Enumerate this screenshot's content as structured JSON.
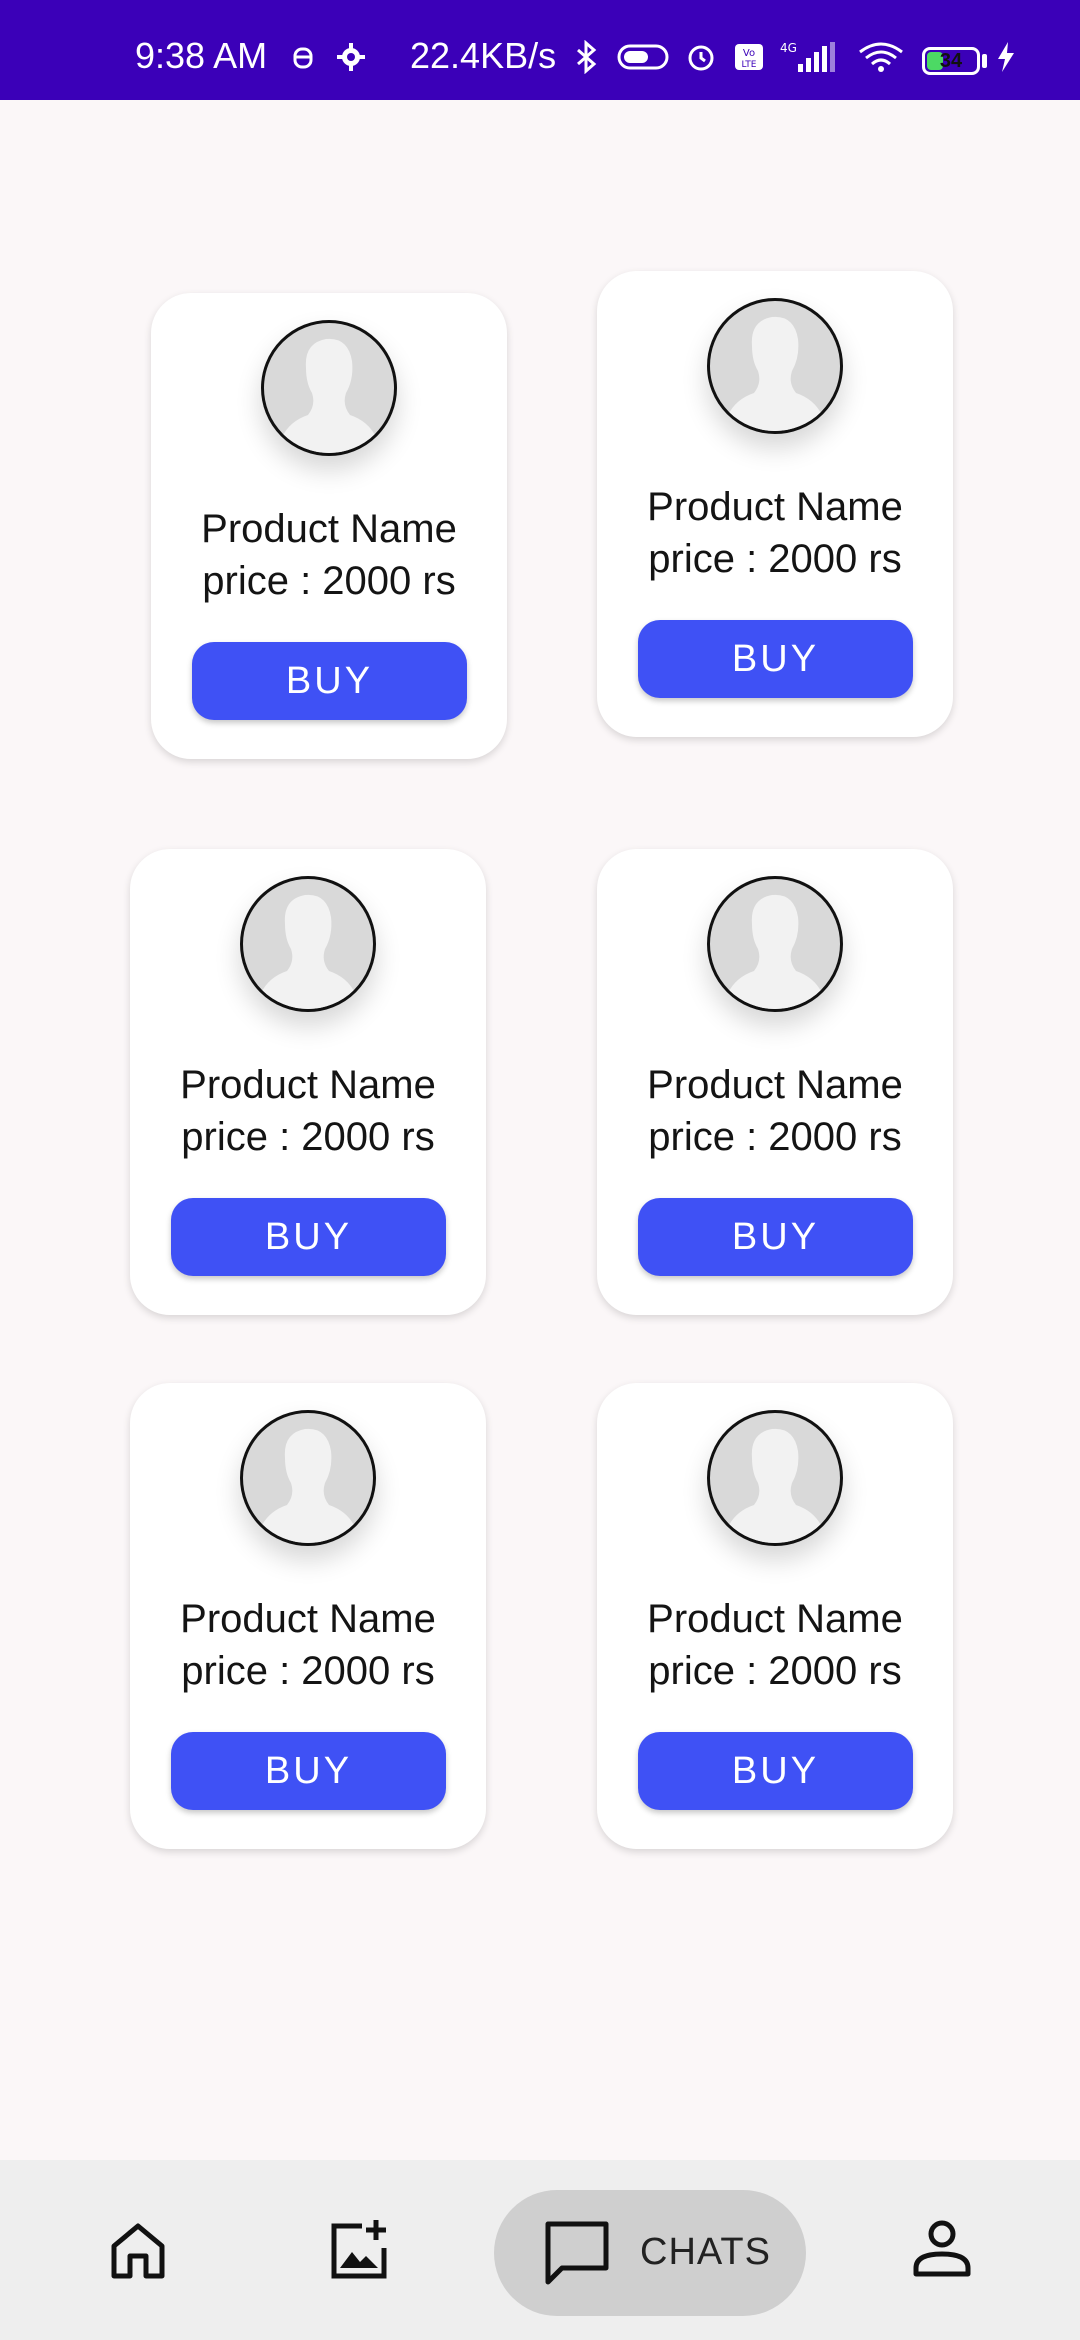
{
  "status_bar": {
    "time": "9:38 AM",
    "network_speed": "22.4KB/s",
    "battery": "34",
    "battery_fraction": 0.34,
    "icons": [
      "android-icon",
      "gear-icon",
      "bluetooth-icon",
      "toggle-icon",
      "alarm-icon",
      "volte-icon",
      "signal-4g-icon",
      "wifi-icon",
      "battery-icon",
      "charging-icon"
    ],
    "bar_color": "#3b00b8"
  },
  "products": [
    {
      "name": "Product Name",
      "price": "price : 2000 rs",
      "button": "BUY"
    },
    {
      "name": "Product Name",
      "price": "price : 2000 rs",
      "button": "BUY"
    },
    {
      "name": "Product Name",
      "price": "price : 2000 rs",
      "button": "BUY"
    },
    {
      "name": "Product Name",
      "price": "price : 2000 rs",
      "button": "BUY"
    },
    {
      "name": "Product Name",
      "price": "price : 2000 rs",
      "button": "BUY"
    },
    {
      "name": "Product Name",
      "price": "price : 2000 rs",
      "button": "BUY"
    }
  ],
  "bottom_nav": {
    "items": [
      {
        "icon": "home-icon",
        "label": ""
      },
      {
        "icon": "add-photo-icon",
        "label": ""
      },
      {
        "icon": "chat-icon",
        "label": "CHATS",
        "selected": true
      },
      {
        "icon": "profile-icon",
        "label": ""
      }
    ]
  },
  "colors": {
    "accent": "#3f51f5",
    "background": "#fbf7f8",
    "nav_background": "#eeeeee",
    "nav_selected": "#cfcfcf"
  }
}
